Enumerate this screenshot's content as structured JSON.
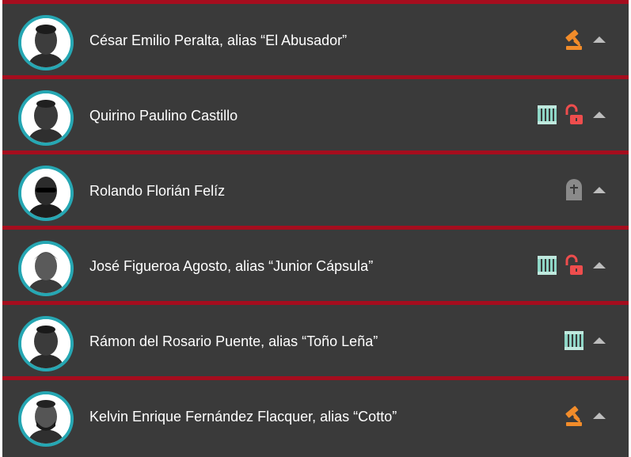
{
  "colors": {
    "row_bg": "#3a3a3a",
    "divider": "#a50d1e",
    "avatar_ring": "#26a7b3",
    "gavel": "#f28c2a",
    "prison": "#8ed6c6",
    "unlock": "#ee4d4d",
    "tombstone": "#8a8a8a",
    "chevron": "#bdbdbd"
  },
  "people": [
    {
      "name": "César Emilio Peralta, alias “El Abusador”",
      "avatar": "portrait-photo",
      "status_icons": [
        "gavel-icon"
      ]
    },
    {
      "name": "Quirino Paulino Castillo",
      "avatar": "portrait-photo",
      "status_icons": [
        "prison-icon",
        "unlock-icon"
      ]
    },
    {
      "name": "Rolando Florián Felíz",
      "avatar": "portrait-photo",
      "status_icons": [
        "tombstone-icon"
      ]
    },
    {
      "name": "José Figueroa Agosto, alias “Junior Cápsula”",
      "avatar": "portrait-photo",
      "status_icons": [
        "prison-icon",
        "unlock-icon"
      ]
    },
    {
      "name": "Rámon del Rosario Puente, alias “Toño Leña”",
      "avatar": "portrait-photo",
      "status_icons": [
        "prison-icon"
      ]
    },
    {
      "name": "Kelvin Enrique Fernández Flacquer, alias “Cotto”",
      "avatar": "portrait-photo",
      "status_icons": [
        "gavel-icon"
      ]
    }
  ]
}
